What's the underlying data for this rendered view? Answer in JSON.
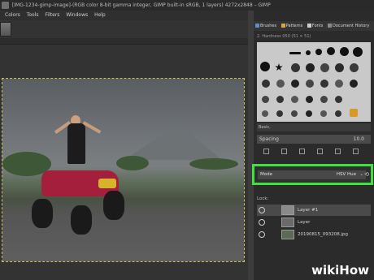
{
  "window": {
    "title": "[IMG-1234-gimp-image]-(RGB color 8-bit gamma integer, GIMP built-in sRGB, 1 layers) 4272x2848 – GIMP"
  },
  "menubar": {
    "items": [
      "Colors",
      "Tools",
      "Filters",
      "Windows",
      "Help"
    ]
  },
  "panel": {
    "tabs": [
      "Brushes",
      "Patterns",
      "Fonts",
      "Document History"
    ],
    "brush_header": "2. Hardness 050 (51 × 51)",
    "preset": "Basic,",
    "spacing_label": "Spacing",
    "spacing_value": "10.0",
    "mode_label": "Mode",
    "mode_value": "HSV Hue",
    "mode_chevron": "⌄",
    "mode_reset": "⟲",
    "lock_label": "Lock:",
    "layers": [
      {
        "name": "Layer #1"
      },
      {
        "name": "Layer"
      },
      {
        "name": "20190815_093208.jpg"
      }
    ]
  },
  "watermark": {
    "wiki": "wiki",
    "how": "How"
  },
  "colors": {
    "highlight": "#3ee23e",
    "brushes_tab": "#5a8fd1",
    "patterns_tab": "#e3a43a",
    "fonts_tab": "#cfcfcf"
  }
}
